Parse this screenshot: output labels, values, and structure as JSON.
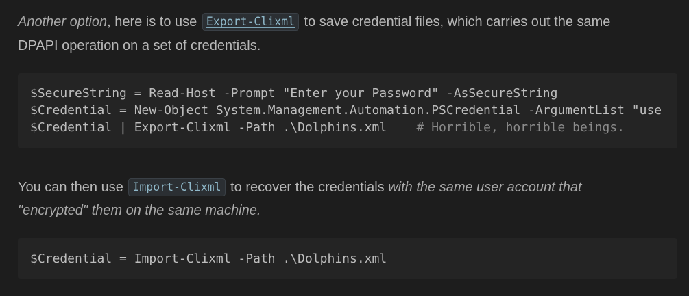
{
  "paragraph1": {
    "line1_em": "Another option",
    "line1_pre": ", here is to use ",
    "line1_code": "Export-Clixml",
    "line1_post": " to save credential files, which carries out the same",
    "line2": "DPAPI operation on a set of credentials."
  },
  "code_block1": {
    "lines": [
      "$SecureString = Read-Host -Prompt \"Enter your Password\" -AsSecureString",
      "$Credential = New-Object System.Management.Automation.PSCredential -ArgumentList \"use",
      "$Credential | Export-Clixml -Path .\\Dolphins.xml    "
    ],
    "comment": "# Horrible, horrible beings."
  },
  "paragraph2": {
    "line1_pre": "You can then use ",
    "line1_code": "Import-Clixml",
    "line1_mid": " to recover the credentials ",
    "line1_em": "with the same user account that",
    "line2_em": "\"encrypted\" them on the same machine."
  },
  "code_block2": {
    "lines": [
      "$Credential = Import-Clixml -Path .\\Dolphins.xml"
    ]
  }
}
